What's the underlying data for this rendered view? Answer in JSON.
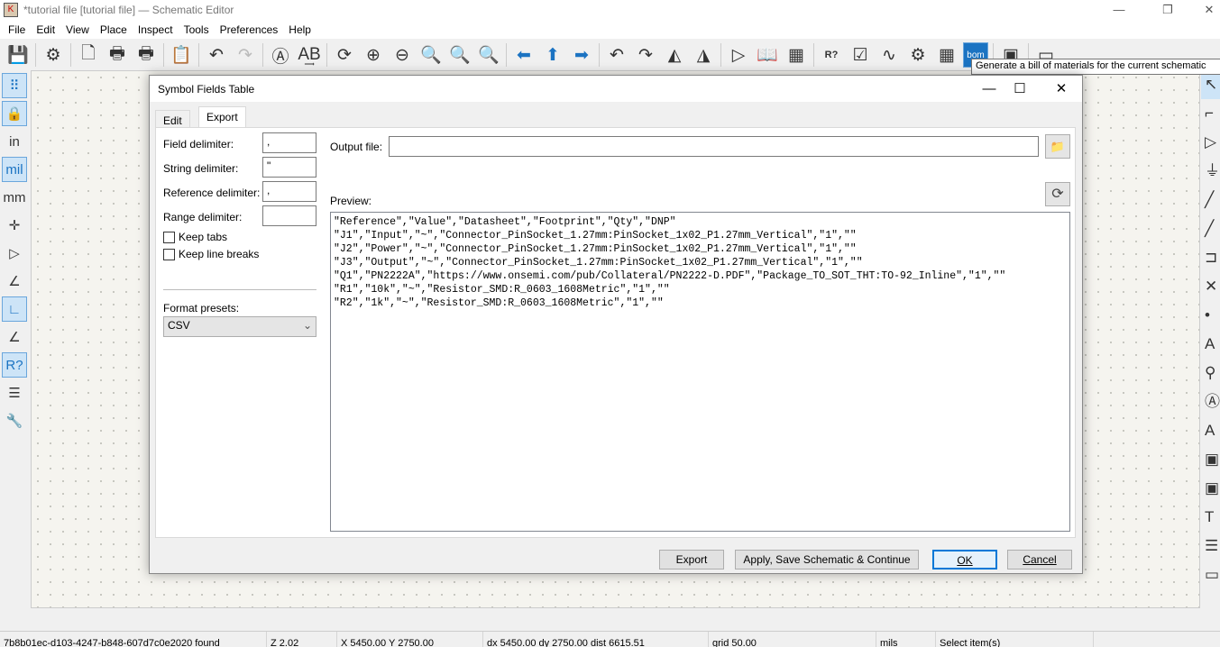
{
  "window": {
    "title": "*tutorial file [tutorial file] — Schematic Editor",
    "minimize": "—",
    "restore": "❐",
    "close": "✕"
  },
  "menu": [
    "File",
    "Edit",
    "View",
    "Place",
    "Inspect",
    "Tools",
    "Preferences",
    "Help"
  ],
  "toolbar": [
    {
      "icon": "save-icon",
      "g": "💾"
    },
    {
      "sep": true
    },
    {
      "icon": "schematic-setup-icon",
      "g": "⚙"
    },
    {
      "sep": true
    },
    {
      "icon": "page-settings-icon",
      "g": "🗋"
    },
    {
      "icon": "print-icon",
      "g": "🖶"
    },
    {
      "icon": "plot-icon",
      "g": "🖶"
    },
    {
      "sep": true
    },
    {
      "icon": "paste-icon",
      "g": "📋",
      "dis": true
    },
    {
      "sep": true
    },
    {
      "icon": "undo-icon",
      "g": "↶"
    },
    {
      "icon": "redo-icon",
      "g": "↷",
      "dis": true
    },
    {
      "sep": true
    },
    {
      "icon": "find-icon",
      "g": "Ⓐ"
    },
    {
      "icon": "find-replace-icon",
      "g": "A͢B"
    },
    {
      "sep": true
    },
    {
      "icon": "refresh-icon",
      "g": "⟳"
    },
    {
      "icon": "zoom-in-icon",
      "g": "⊕"
    },
    {
      "icon": "zoom-out-icon",
      "g": "⊖"
    },
    {
      "icon": "zoom-page-icon",
      "g": "🔍"
    },
    {
      "icon": "zoom-objects-icon",
      "g": "🔍"
    },
    {
      "icon": "zoom-selection-icon",
      "g": "🔍"
    },
    {
      "sep": true
    },
    {
      "icon": "navigate-back-icon",
      "g": "⬅",
      "blue": true
    },
    {
      "icon": "navigate-up-icon",
      "g": "⬆",
      "blue": true
    },
    {
      "icon": "navigate-forward-icon",
      "g": "➡",
      "blue": true
    },
    {
      "sep": true
    },
    {
      "icon": "rotate-ccw-icon",
      "g": "↶"
    },
    {
      "icon": "rotate-cw-icon",
      "g": "↷"
    },
    {
      "icon": "mirror-vertical-icon",
      "g": "◭"
    },
    {
      "icon": "mirror-horizontal-icon",
      "g": "◮"
    },
    {
      "sep": true
    },
    {
      "icon": "symbol-editor-icon",
      "g": "▷"
    },
    {
      "icon": "symbol-library-browser-icon",
      "g": "📖"
    },
    {
      "icon": "footprint-editor-icon",
      "g": "▦"
    },
    {
      "sep": true
    },
    {
      "icon": "annotate-icon",
      "g": "R?"
    },
    {
      "icon": "erc-icon",
      "g": "☑"
    },
    {
      "icon": "simulator-icon",
      "g": "∿"
    },
    {
      "icon": "assign-footprints-icon",
      "g": "⚙"
    },
    {
      "icon": "symbol-fields-table-icon",
      "g": "▦"
    },
    {
      "icon": "bom-icon",
      "g": "bom",
      "act": true
    },
    {
      "sep": true
    },
    {
      "icon": "pcb-editor-icon",
      "g": "▣"
    },
    {
      "sep": true
    },
    {
      "icon": "scripting-console-icon",
      "g": "▭"
    }
  ],
  "tooltip": "Generate a bill of materials for the current schematic",
  "left_toolbar": [
    {
      "icon": "grid-icon",
      "g": "⠿",
      "act": true
    },
    {
      "icon": "grid-lock-icon",
      "g": "🔒",
      "act": true
    },
    {
      "icon": "units-inches-icon",
      "g": "in"
    },
    {
      "icon": "units-mils-icon",
      "g": "mil",
      "act": true
    },
    {
      "icon": "units-mm-icon",
      "g": "mm"
    },
    {
      "icon": "cursor-crosshair-icon",
      "g": "✛"
    },
    {
      "icon": "hidden-pins-icon",
      "g": "▷"
    },
    {
      "icon": "line-mode-free-icon",
      "g": "∠"
    },
    {
      "icon": "line-mode-90-icon",
      "g": "∟",
      "act": true
    },
    {
      "icon": "line-mode-45-icon",
      "g": "∠"
    },
    {
      "icon": "annotation-icon",
      "g": "R?",
      "act": true
    },
    {
      "icon": "hierarchy-navigator-icon",
      "g": "☰"
    },
    {
      "icon": "properties-icon",
      "g": "🔧"
    }
  ],
  "right_toolbar": [
    {
      "icon": "select-icon",
      "g": "↖",
      "act": true
    },
    {
      "icon": "highlight-net-icon",
      "g": "⌐"
    },
    {
      "icon": "add-symbol-icon",
      "g": "▷"
    },
    {
      "icon": "add-power-icon",
      "g": "⏚"
    },
    {
      "icon": "add-wire-icon",
      "g": "╱"
    },
    {
      "icon": "add-bus-icon",
      "g": "╱"
    },
    {
      "icon": "add-bus-entry-icon",
      "g": "⊐"
    },
    {
      "icon": "no-connect-icon",
      "g": "✕"
    },
    {
      "icon": "add-junction-icon",
      "g": "•"
    },
    {
      "icon": "add-label-icon",
      "g": "A"
    },
    {
      "icon": "add-netclass-icon",
      "g": "⚲"
    },
    {
      "icon": "add-global-label-icon",
      "g": "Ⓐ"
    },
    {
      "icon": "add-hierarchical-label-icon",
      "g": "A"
    },
    {
      "icon": "add-sheet-icon",
      "g": "▣"
    },
    {
      "icon": "import-sheet-pin-icon",
      "g": "▣"
    },
    {
      "icon": "add-text-icon",
      "g": "T"
    },
    {
      "icon": "add-textbox-icon",
      "g": "☰"
    },
    {
      "icon": "add-rectangle-icon",
      "g": "▭"
    }
  ],
  "status": {
    "message": "7b8b01ec-d103-4247-b848-607d7c0e2020 found",
    "zoom": "Z 2.02",
    "coords": "X 5450.00  Y 2750.00",
    "delta": "dx 5450.00  dy 2750.00  dist 6615.51",
    "grid": "grid 50.00",
    "units": "mils",
    "tool": "Select item(s)"
  },
  "dialog": {
    "title": "Symbol Fields Table",
    "tabs": [
      "Edit",
      "Export"
    ],
    "active_tab": "Export",
    "field_delimiter_label": "Field delimiter:",
    "field_delimiter": ",",
    "string_delimiter_label": "String delimiter:",
    "string_delimiter": "\"",
    "reference_delimiter_label": "Reference delimiter:",
    "reference_delimiter": ",",
    "range_delimiter_label": "Range delimiter:",
    "range_delimiter": "",
    "keep_tabs_label": "Keep tabs",
    "keep_tabs": false,
    "keep_line_breaks_label": "Keep line breaks",
    "keep_line_breaks": false,
    "format_presets_label": "Format presets:",
    "format_preset": "CSV",
    "output_file_label": "Output file:",
    "output_file": "",
    "preview_label": "Preview:",
    "preview_lines": [
      "\"Reference\",\"Value\",\"Datasheet\",\"Footprint\",\"Qty\",\"DNP\"",
      "\"J1\",\"Input\",\"~\",\"Connector_PinSocket_1.27mm:PinSocket_1x02_P1.27mm_Vertical\",\"1\",\"\"",
      "\"J2\",\"Power\",\"~\",\"Connector_PinSocket_1.27mm:PinSocket_1x02_P1.27mm_Vertical\",\"1\",\"\"",
      "\"J3\",\"Output\",\"~\",\"Connector_PinSocket_1.27mm:PinSocket_1x02_P1.27mm_Vertical\",\"1\",\"\"",
      "\"Q1\",\"PN2222A\",\"https://www.onsemi.com/pub/Collateral/PN2222-D.PDF\",\"Package_TO_SOT_THT:TO-92_Inline\",\"1\",\"\"",
      "\"R1\",\"10k\",\"~\",\"Resistor_SMD:R_0603_1608Metric\",\"1\",\"\"",
      "\"R2\",\"1k\",\"~\",\"Resistor_SMD:R_0603_1608Metric\",\"1\",\"\""
    ],
    "buttons": {
      "export": "Export",
      "apply": "Apply, Save Schematic & Continue",
      "ok": "OK",
      "cancel": "Cancel"
    }
  }
}
